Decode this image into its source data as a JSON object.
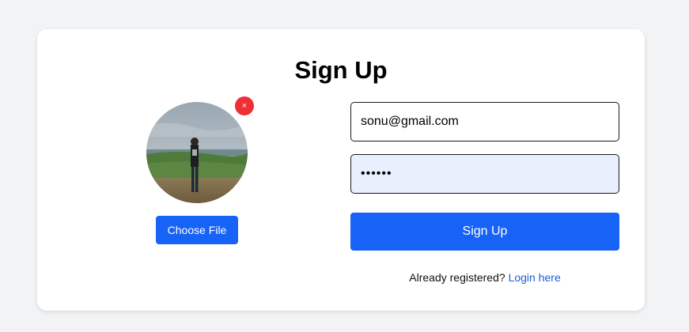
{
  "form": {
    "title": "Sign Up",
    "email_value": "sonu@gmail.com",
    "password_value": "******",
    "submit_label": "Sign Up"
  },
  "avatar": {
    "remove_label": "×",
    "choose_file_label": "Choose File"
  },
  "footer": {
    "prompt": "Already registered?",
    "login_link": "Login here"
  },
  "colors": {
    "primary": "#1762f7",
    "remove": "#ee2f36",
    "link": "#1d5fd0",
    "page_bg": "#f2f3f5"
  }
}
